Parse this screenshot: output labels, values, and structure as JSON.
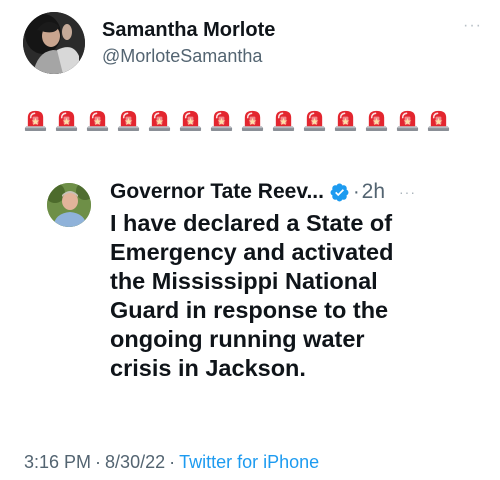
{
  "tweet": {
    "author": {
      "display_name": "Samantha Morlote",
      "handle": "@MorloteSamantha"
    },
    "more_label": "···",
    "body_emoji": [
      "siren-icon",
      "siren-icon",
      "siren-icon",
      "siren-icon",
      "siren-icon",
      "siren-icon",
      "siren-icon",
      "siren-icon",
      "siren-icon",
      "siren-icon",
      "siren-icon",
      "siren-icon",
      "siren-icon",
      "siren-icon"
    ],
    "quoted": {
      "display_name": "Governor Tate Reev...",
      "verified": true,
      "dot": "·",
      "time": "2h",
      "more_label": "···",
      "text": "I have declared a State of\nEmergency and activated\nthe Mississippi National\nGuard in response to the\nongoing running water\ncrisis in Jackson."
    },
    "meta": {
      "time": "3:16 PM",
      "sep1": "·",
      "date": "8/30/22",
      "sep2": "·",
      "source": "Twitter for iPhone"
    }
  },
  "colors": {
    "text_primary": "#0f1419",
    "text_secondary": "#536471",
    "link": "#1d9bf0",
    "verified": "#1d9bf0",
    "siren_red": "#e3262f"
  }
}
